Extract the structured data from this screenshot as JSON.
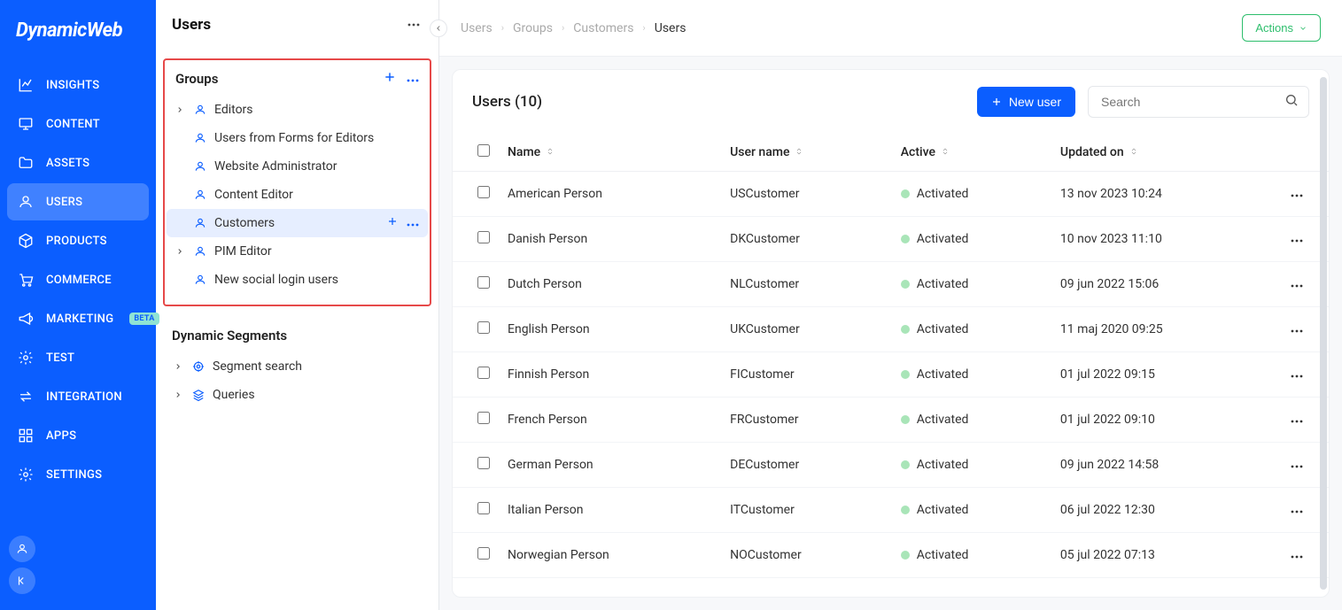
{
  "brand": "DynamicWeb",
  "nav": {
    "items": [
      {
        "label": "INSIGHTS",
        "icon": "chart",
        "active": false
      },
      {
        "label": "CONTENT",
        "icon": "monitor",
        "active": false
      },
      {
        "label": "ASSETS",
        "icon": "folder",
        "active": false
      },
      {
        "label": "USERS",
        "icon": "user",
        "active": true
      },
      {
        "label": "PRODUCTS",
        "icon": "package",
        "active": false
      },
      {
        "label": "COMMERCE",
        "icon": "cart",
        "active": false
      },
      {
        "label": "MARKETING",
        "icon": "megaphone",
        "active": false,
        "badge": "BETA"
      },
      {
        "label": "TEST",
        "icon": "gear",
        "active": false
      },
      {
        "label": "INTEGRATION",
        "icon": "swap",
        "active": false
      },
      {
        "label": "APPS",
        "icon": "grid",
        "active": false
      },
      {
        "label": "SETTINGS",
        "icon": "gear",
        "active": false
      }
    ]
  },
  "panel": {
    "title": "Users",
    "groups_label": "Groups",
    "groups": [
      {
        "label": "Editors",
        "expandable": true,
        "selected": false
      },
      {
        "label": "Users from Forms for Editors",
        "expandable": false,
        "selected": false
      },
      {
        "label": "Website Administrator",
        "expandable": false,
        "selected": false
      },
      {
        "label": "Content Editor",
        "expandable": false,
        "selected": false
      },
      {
        "label": "Customers",
        "expandable": false,
        "selected": true
      },
      {
        "label": "PIM Editor",
        "expandable": true,
        "selected": false
      },
      {
        "label": "New social login users",
        "expandable": false,
        "selected": false
      }
    ],
    "segments_label": "Dynamic Segments",
    "segments": [
      {
        "label": "Segment search",
        "icon": "target"
      },
      {
        "label": "Queries",
        "icon": "layers"
      }
    ]
  },
  "breadcrumb": [
    "Users",
    "Groups",
    "Customers",
    "Users"
  ],
  "actions_label": "Actions",
  "card": {
    "title": "Users (10)",
    "new_user_label": "New user",
    "search_placeholder": "Search"
  },
  "columns": {
    "name": "Name",
    "username": "User name",
    "active": "Active",
    "updated": "Updated on"
  },
  "rows": [
    {
      "name": "American Person",
      "username": "USCustomer",
      "status": "Activated",
      "updated": "13 nov 2023 10:24"
    },
    {
      "name": "Danish Person",
      "username": "DKCustomer",
      "status": "Activated",
      "updated": "10 nov 2023 11:10"
    },
    {
      "name": "Dutch Person",
      "username": "NLCustomer",
      "status": "Activated",
      "updated": "09 jun 2022 15:06"
    },
    {
      "name": "English Person",
      "username": "UKCustomer",
      "status": "Activated",
      "updated": "11 maj 2020 09:25"
    },
    {
      "name": "Finnish Person",
      "username": "FICustomer",
      "status": "Activated",
      "updated": "01 jul 2022 09:15"
    },
    {
      "name": "French Person",
      "username": "FRCustomer",
      "status": "Activated",
      "updated": "01 jul 2022 09:10"
    },
    {
      "name": "German Person",
      "username": "DECustomer",
      "status": "Activated",
      "updated": "09 jun 2022 14:58"
    },
    {
      "name": "Italian Person",
      "username": "ITCustomer",
      "status": "Activated",
      "updated": "06 jul 2022 12:30"
    },
    {
      "name": "Norwegian Person",
      "username": "NOCustomer",
      "status": "Activated",
      "updated": "05 jul 2022 07:13"
    }
  ]
}
